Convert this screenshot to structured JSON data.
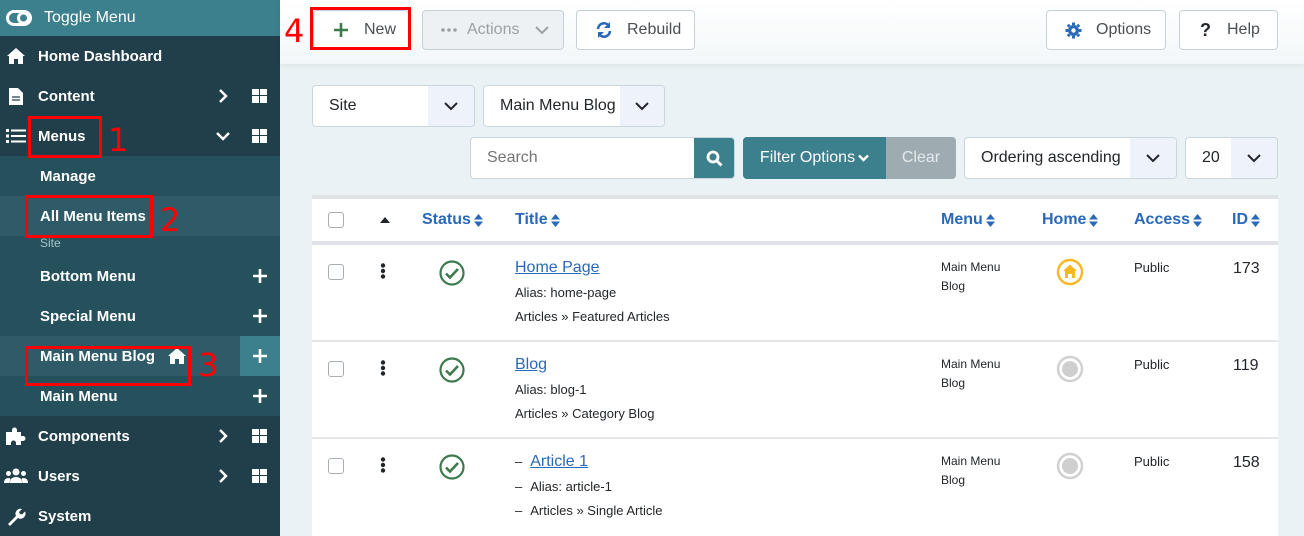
{
  "sidebar": {
    "toggle_label": "Toggle Menu",
    "items": [
      {
        "label": "Home Dashboard",
        "icon": "home-icon"
      },
      {
        "label": "Content",
        "icon": "file-icon"
      },
      {
        "label": "Menus",
        "icon": "list-icon"
      }
    ],
    "menus_sub": {
      "manage": "Manage",
      "all_items": "All Menu Items",
      "site_heading": "Site",
      "menus": [
        "Bottom Menu",
        "Special Menu",
        "Main Menu Blog",
        "Main Menu"
      ]
    },
    "bottom_items": [
      {
        "label": "Components",
        "icon": "puzzle-icon"
      },
      {
        "label": "Users",
        "icon": "users-icon"
      },
      {
        "label": "System",
        "icon": "wrench-icon"
      }
    ]
  },
  "annotations": [
    "1",
    "2",
    "3",
    "4"
  ],
  "toolbar": {
    "new_label": "New",
    "actions_label": "Actions",
    "rebuild_label": "Rebuild",
    "options_label": "Options",
    "help_label": "Help"
  },
  "filters": {
    "client_select": "Site",
    "menu_select": "Main Menu Blog",
    "search_placeholder": "Search",
    "filter_options_label": "Filter Options",
    "clear_label": "Clear",
    "ordering_select": "Ordering ascending",
    "limit_select": "20"
  },
  "table": {
    "headers": {
      "status": "Status",
      "title": "Title",
      "menu": "Menu",
      "home": "Home",
      "access": "Access",
      "id": "ID"
    },
    "rows": [
      {
        "title": "Home Page",
        "alias": "Alias: home-page",
        "type": "Articles » Featured Articles",
        "menu_line1": "Main Menu",
        "menu_line2": "Blog",
        "home": "default",
        "access": "Public",
        "id": "173",
        "level_prefix": ""
      },
      {
        "title": "Blog",
        "alias": "Alias: blog-1",
        "type": "Articles » Category Blog",
        "menu_line1": "Main Menu",
        "menu_line2": "Blog",
        "home": "not-default",
        "access": "Public",
        "id": "119",
        "level_prefix": ""
      },
      {
        "title": "Article 1",
        "alias": "Alias: article-1",
        "type": "Articles » Single Article",
        "menu_line1": "Main Menu",
        "menu_line2": "Blog",
        "home": "not-default",
        "access": "Public",
        "id": "158",
        "level_prefix": "–"
      }
    ]
  },
  "colors": {
    "sidebar_bg": "#213f4a",
    "accent": "#3c7f8d",
    "link": "#2a69b8",
    "published": "#3e7a4e",
    "home_default": "#f9b821"
  }
}
